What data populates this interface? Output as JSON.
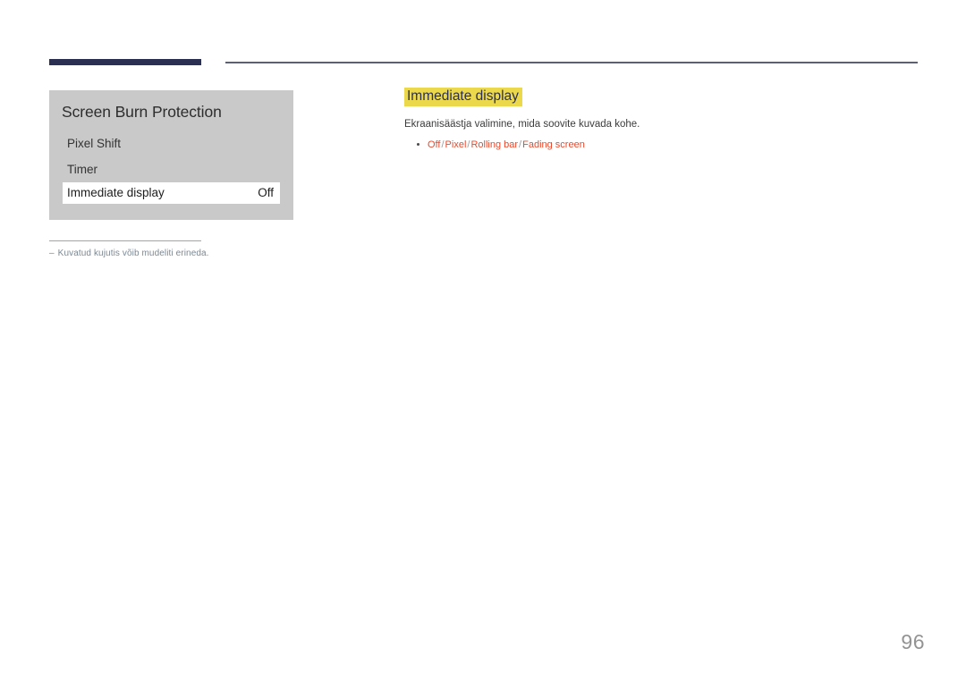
{
  "header": {
    "accent_bar_color": "#2b3052",
    "rule_color": "#5b5f78"
  },
  "osd_panel": {
    "title": "Screen Burn Protection",
    "background_color": "#c9c9c9",
    "rows": [
      {
        "label": "Pixel Shift",
        "value": "",
        "selected": false
      },
      {
        "label": "Timer",
        "value": "",
        "selected": false
      },
      {
        "label": "Immediate display",
        "value": "Off",
        "selected": true
      }
    ]
  },
  "footnote": {
    "dash": "‒",
    "text": "Kuvatud kujutis võib mudeliti erineda."
  },
  "content": {
    "heading": "Immediate display",
    "heading_highlight_color": "#ecd94b",
    "heading_text_color": "#2b3052",
    "description": "Ekraanisäästja valimine, mida soovite kuvada kohe.",
    "options": [
      {
        "label": "Off"
      },
      {
        "label": "Pixel"
      },
      {
        "label": "Rolling bar"
      },
      {
        "label": "Fading screen"
      }
    ],
    "option_separator": "/",
    "option_color": "#e8492d"
  },
  "page_number": "96"
}
